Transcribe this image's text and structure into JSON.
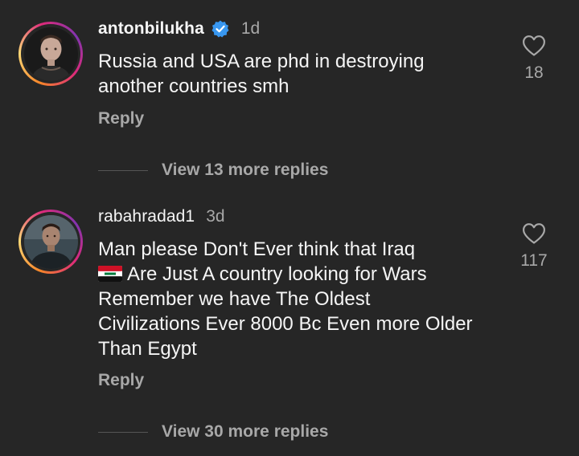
{
  "comments": [
    {
      "username": "antonbilukha",
      "verified": true,
      "time": "1d",
      "text": "Russia and USA are phd in destroying another countries smh",
      "reply_label": "Reply",
      "likes": "18",
      "view_replies": "View 13 more replies"
    },
    {
      "username": "rabahradad1",
      "verified": false,
      "time": "3d",
      "text": "Are Just A country looking for Wars Remember we have The Oldest Civilizations Ever 8000 Bc Even more Older Than Egypt",
      "text_prefix": "Man please Don't Ever think that Iraq",
      "reply_label": "Reply",
      "likes": "117",
      "view_replies": "View 30 more replies"
    }
  ],
  "icons": {
    "verified": "verified-badge-icon",
    "like": "heart-icon",
    "flag": "iraq-flag-emoji"
  },
  "colors": {
    "background": "#262626",
    "primary_text": "#f5f5f5",
    "secondary_text": "#a8a8a8",
    "verified_blue": "#3897f0"
  }
}
